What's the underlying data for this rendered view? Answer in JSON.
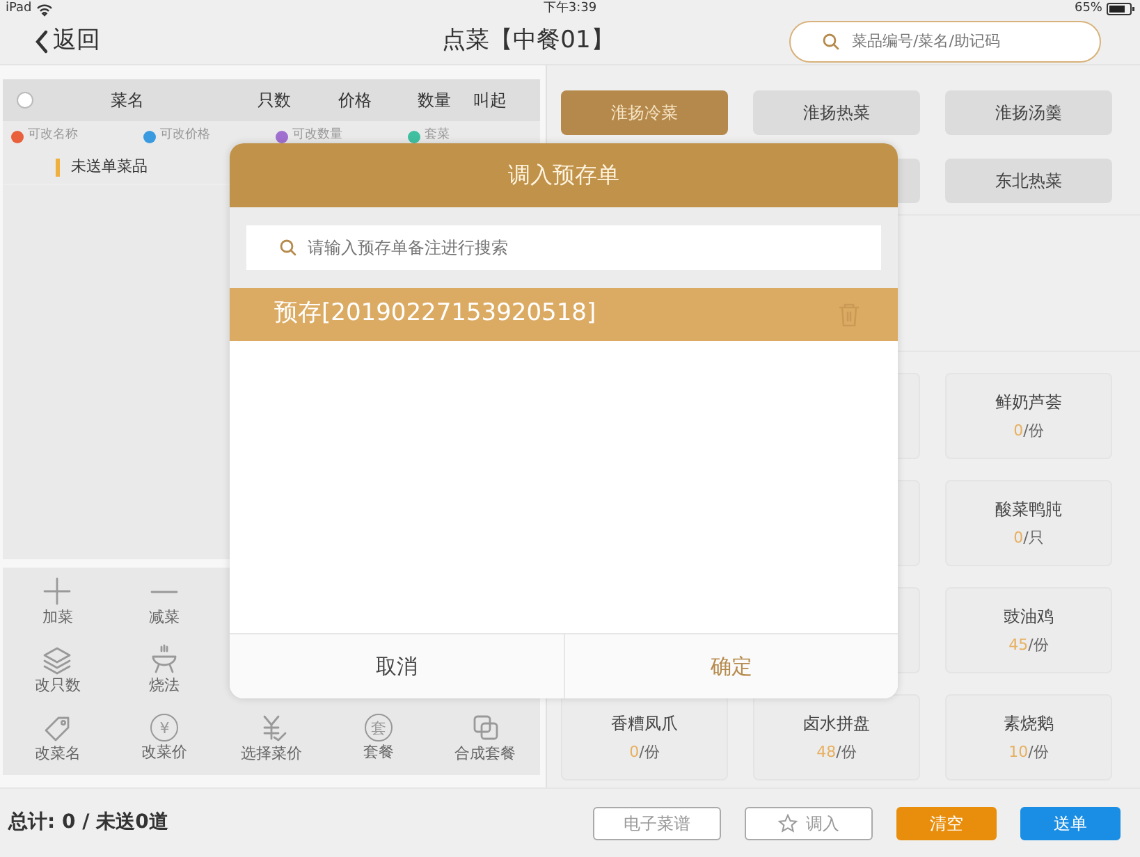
{
  "status_bar": {
    "device": "iPad",
    "time": "下午3:39",
    "battery": "65%"
  },
  "header": {
    "back": "返回",
    "title": "点菜【中餐01】",
    "search": {
      "placeholder": "菜品编号/菜名/助记码"
    }
  },
  "order_table": {
    "select_all": {
      "checked": false
    },
    "columns": [
      "菜名",
      "只数",
      "价格",
      "数量",
      "叫起"
    ],
    "legend": [
      {
        "label": "可改名称",
        "color": "#e8603c"
      },
      {
        "label": "可改价格",
        "color": "#3a9ae0"
      },
      {
        "label": "可改数量",
        "color": "#a070d0"
      },
      {
        "label": "套菜",
        "color": "#40c0a0"
      }
    ],
    "groups": [
      {
        "label": "未送单菜品"
      }
    ]
  },
  "tools": [
    [
      {
        "label": "加菜",
        "kind": "plus"
      },
      {
        "label": "减菜",
        "kind": "minus"
      }
    ],
    [
      {
        "label": "改只数",
        "kind": "layers"
      },
      {
        "label": "烧法",
        "kind": "grill"
      }
    ],
    [
      {
        "label": "改菜名",
        "kind": "tag"
      },
      {
        "label": "改菜价",
        "kind": "glyph",
        "glyph": "¥"
      },
      {
        "label": "选择菜价",
        "kind": "yen-check"
      },
      {
        "label": "套餐",
        "kind": "glyph",
        "glyph": "套"
      },
      {
        "label": "合成套餐",
        "kind": "squares"
      }
    ]
  ],
  "categories": [
    [
      {
        "label": "淮扬冷菜",
        "selected": true
      },
      {
        "label": "淮扬热菜",
        "selected": false
      },
      {
        "label": "淮扬汤羹",
        "selected": false
      }
    ],
    [
      {
        "label": "东北热菜",
        "selected": false
      }
    ]
  ],
  "dishes": [
    [
      {
        "name": "鲜奶芦荟",
        "count": "0",
        "unit": "/份"
      }
    ],
    [
      {
        "name": "酸菜鸭肫",
        "count": "0",
        "unit": "/只"
      }
    ],
    [
      {
        "name": "豉油鸡",
        "count": "45",
        "unit": "/份"
      }
    ],
    [
      {
        "name": "香糟凤爪",
        "count": "0",
        "unit": "/份"
      },
      {
        "name": "卤水拼盘",
        "count": "48",
        "unit": "/份"
      },
      {
        "name": "素烧鹅",
        "count": "10",
        "unit": "/份"
      }
    ]
  ],
  "footer": {
    "total": "总计: 0 / 未送0道",
    "buttons": [
      {
        "label": "电子菜谱",
        "kind": "outline"
      },
      {
        "label": "调入",
        "kind": "outline-star"
      },
      {
        "label": "清空",
        "kind": "warning"
      },
      {
        "label": "送单",
        "kind": "primary"
      }
    ]
  },
  "dialog": {
    "title": "调入预存单",
    "search": {
      "placeholder": "请输入预存单备注进行搜索"
    },
    "items": [
      {
        "label": "预存[20190227153920518]",
        "selected": true
      }
    ],
    "buttons": [
      {
        "label": "取消",
        "kind": "cancel"
      },
      {
        "label": "确定",
        "kind": "confirm"
      }
    ]
  }
}
